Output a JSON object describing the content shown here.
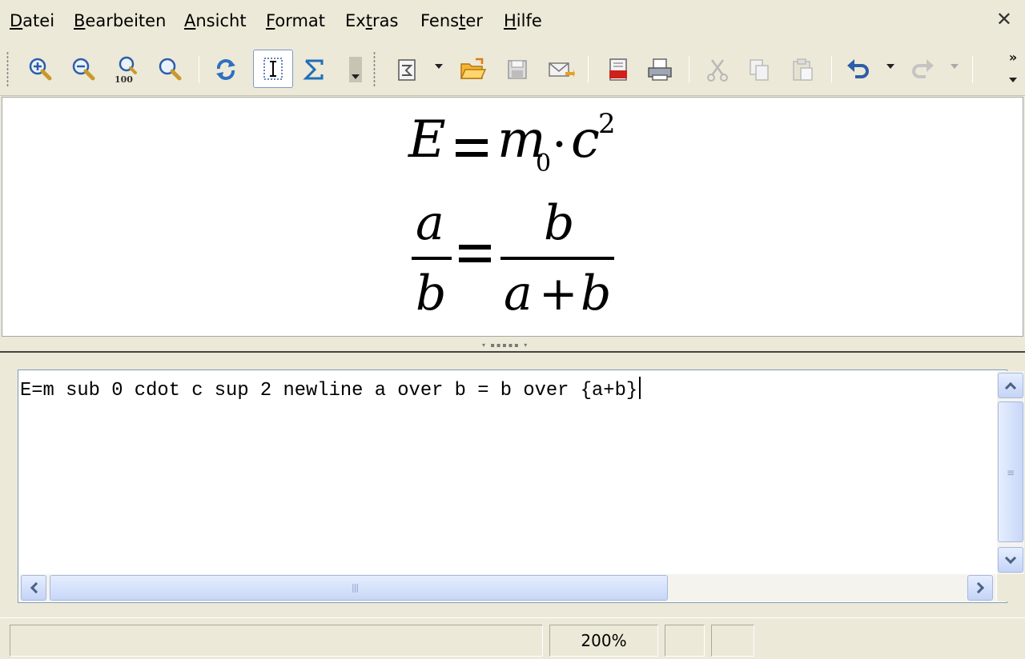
{
  "menubar": {
    "items": [
      {
        "label": "Datei",
        "mnemonic": "D",
        "rest": "atei"
      },
      {
        "label": "Bearbeiten",
        "mnemonic": "B",
        "rest": "earbeiten"
      },
      {
        "label": "Ansicht",
        "mnemonic": "A",
        "rest": "nsicht"
      },
      {
        "label": "Format",
        "mnemonic": "F",
        "rest": "ormat"
      },
      {
        "label": "Extras",
        "pre": "Ex",
        "mnemonic": "t",
        "rest": "ras"
      },
      {
        "label": "Fenster",
        "pre": "Fens",
        "mnemonic": "t",
        "rest": "er"
      },
      {
        "label": "Hilfe",
        "mnemonic": "H",
        "rest": "ilfe"
      }
    ],
    "close_glyph": "✕"
  },
  "toolbar": {
    "zoom_100_label": "100",
    "overflow_glyph": "»",
    "buttons": [
      "zoom-in-icon",
      "zoom-out-icon",
      "zoom-100-icon",
      "show-all-icon",
      "update-icon",
      "formula-cursor-icon",
      "symbols-icon",
      "load-template-icon",
      "open-icon",
      "save-icon",
      "email-icon",
      "export-pdf-icon",
      "print-icon",
      "cut-icon",
      "copy-icon",
      "paste-icon",
      "undo-icon",
      "redo-icon"
    ]
  },
  "preview": {
    "line1": {
      "E": "E",
      "m": "m",
      "sub": "0",
      "dot": "·",
      "c": "c",
      "sup": "2"
    },
    "line2": {
      "num_left": "a",
      "den_left": "b",
      "num_right": "b",
      "den_right_a": "a",
      "den_right_plus": "+",
      "den_right_b": "b"
    }
  },
  "editor": {
    "command_text": "E=m sub 0 cdot c sup 2 newline a over b = b over {a+b}"
  },
  "statusbar": {
    "message": "",
    "zoom": "200%",
    "cell3": "",
    "cell4": ""
  },
  "colors": {
    "chrome": "#ece9d8",
    "scroll_accent": "#4d6185",
    "active_border": "#7a99c8"
  }
}
